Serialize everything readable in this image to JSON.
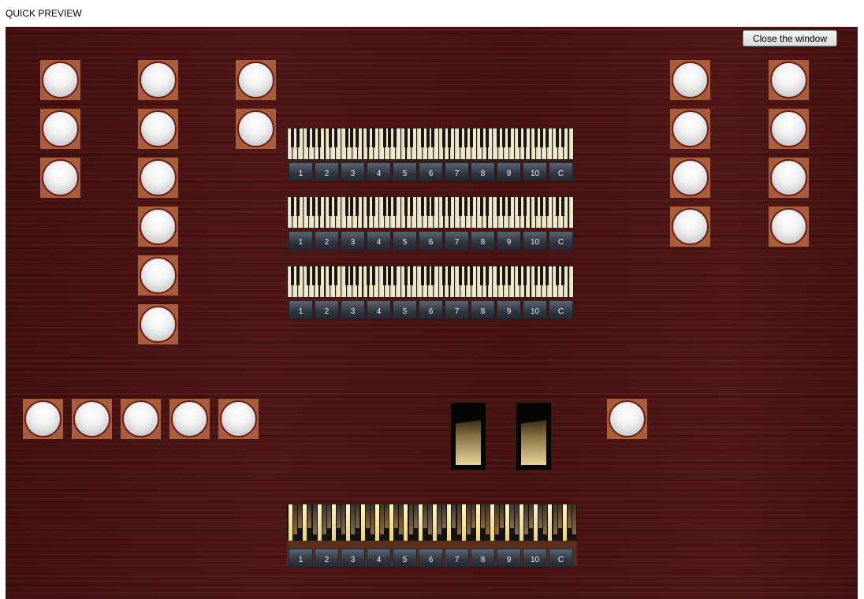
{
  "window": {
    "title": "QUICK PREVIEW"
  },
  "toolbar": {
    "close_label": "Close the window"
  },
  "manual_pistons": [
    "1",
    "2",
    "3",
    "4",
    "5",
    "6",
    "7",
    "8",
    "9",
    "10",
    "C"
  ],
  "pedal_pistons": [
    "1",
    "2",
    "3",
    "4",
    "5",
    "6",
    "7",
    "8",
    "9",
    "10",
    "C"
  ],
  "colors": {
    "wood": "#4a1010",
    "stop_surround": "#a85e3a",
    "knob": "#ececec",
    "keyboard_white": "#efe6c9",
    "pedal_key": "#f1e39a"
  }
}
